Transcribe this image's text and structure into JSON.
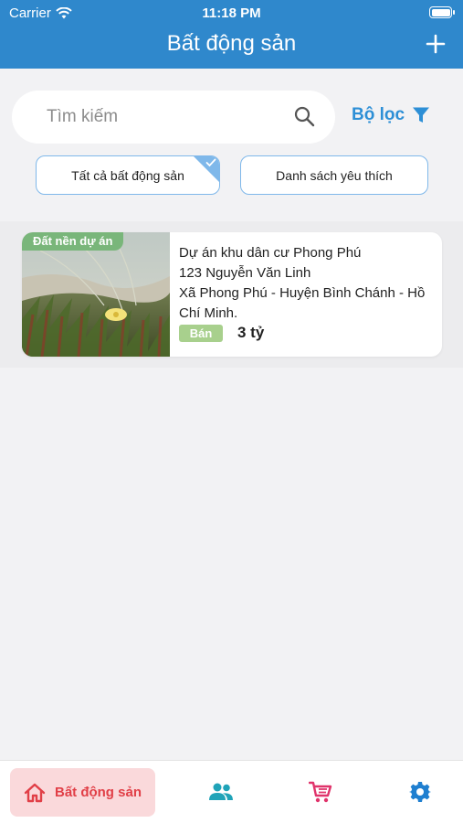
{
  "status_bar": {
    "carrier": "Carrier",
    "time": "11:18 PM"
  },
  "header": {
    "title": "Bất động sản"
  },
  "search": {
    "placeholder": "Tìm kiếm"
  },
  "filter": {
    "label": "Bộ lọc"
  },
  "chips": [
    {
      "label": "Tất cả bất động sản",
      "selected": true
    },
    {
      "label": "Danh sách yêu thích",
      "selected": false
    }
  ],
  "listings": [
    {
      "tag": "Đất nền dự án",
      "title": "Dự án khu dân cư Phong Phú",
      "street": "123 Nguyễn Văn Linh",
      "area": "Xã Phong Phú - Huyện Bình Chánh - Hồ Chí Minh.",
      "type": "Bán",
      "price": "3 tỷ"
    }
  ],
  "tabs": [
    {
      "label": "Bất động sản",
      "icon": "home-icon",
      "active": true
    },
    {
      "label": "",
      "icon": "users-icon",
      "active": false
    },
    {
      "label": "",
      "icon": "cart-icon",
      "active": false
    },
    {
      "label": "",
      "icon": "gear-icon",
      "active": false
    }
  ],
  "colors": {
    "header": "#2f88cc",
    "accent": "#2d8fd6",
    "active_tab": "#e13f47",
    "active_tab_bg": "#fad9db",
    "tag": "#79b67a",
    "sell_badge": "#a8d08d",
    "users_icon": "#1fa3b8",
    "cart_icon": "#e0336b",
    "gear_icon": "#1f7fd0"
  }
}
